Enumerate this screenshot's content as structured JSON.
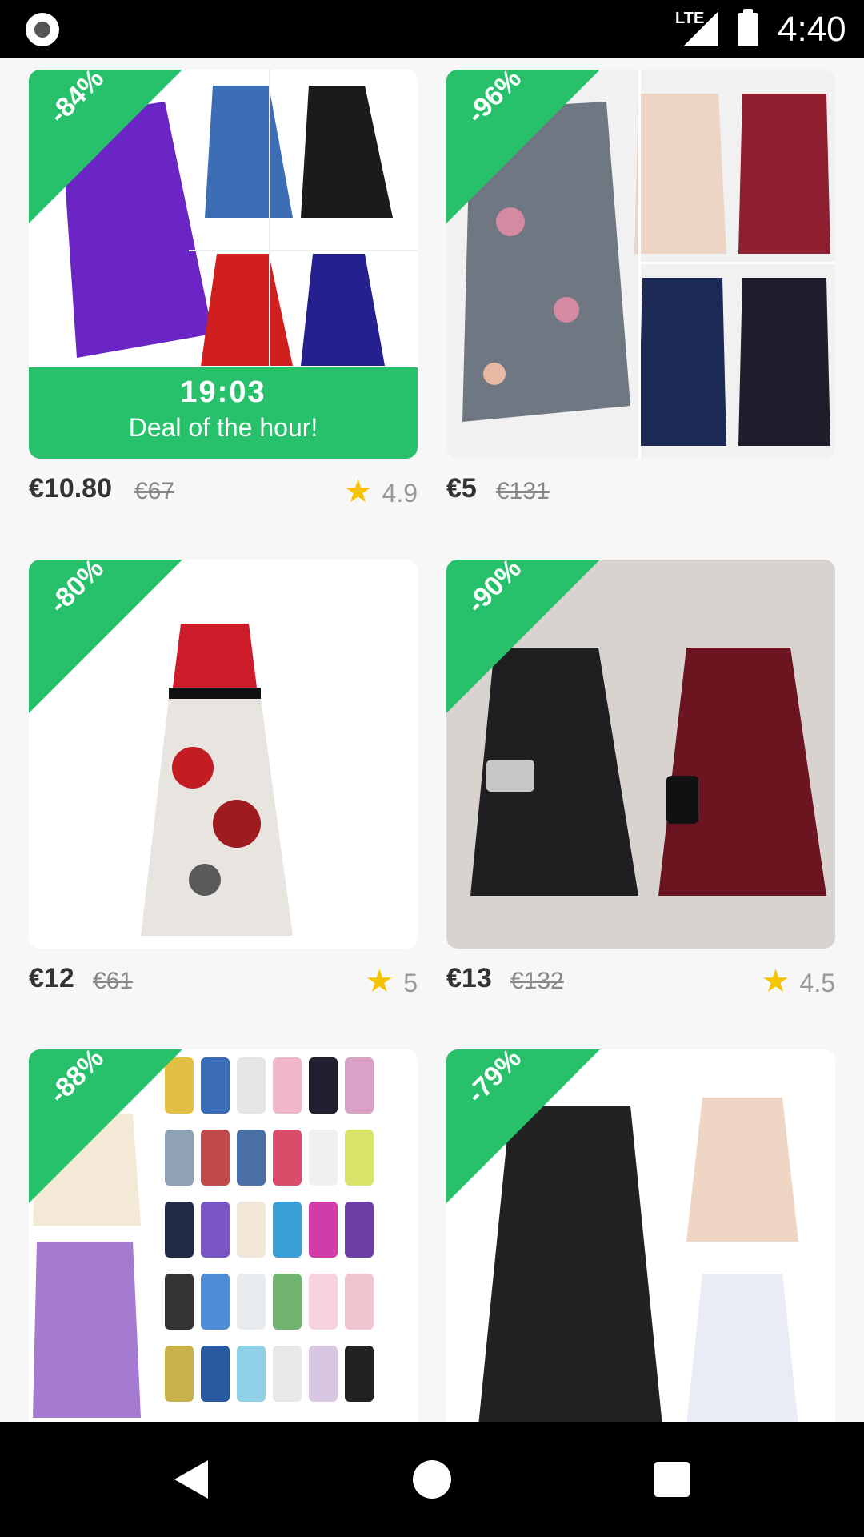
{
  "status_bar": {
    "network": "LTE",
    "time": "4:40"
  },
  "products": [
    {
      "discount": "-84%",
      "price": "€10.80",
      "old_price": "€67",
      "rating": "4.9",
      "deal_timer": "19:03",
      "deal_label": "Deal of the hour!"
    },
    {
      "discount": "-96%",
      "price": "€5",
      "old_price": "€131",
      "rating": ""
    },
    {
      "discount": "-80%",
      "price": "€12",
      "old_price": "€61",
      "rating": "5"
    },
    {
      "discount": "-90%",
      "price": "€13",
      "old_price": "€132",
      "rating": "4.5"
    },
    {
      "discount": "-88%"
    },
    {
      "discount": "-79%"
    }
  ],
  "colors": {
    "accent": "#27c06b",
    "star": "#f5c400"
  },
  "icons": {
    "back": "back-icon",
    "home": "home-icon",
    "recent": "recent-apps-icon",
    "rating": "star-icon"
  }
}
